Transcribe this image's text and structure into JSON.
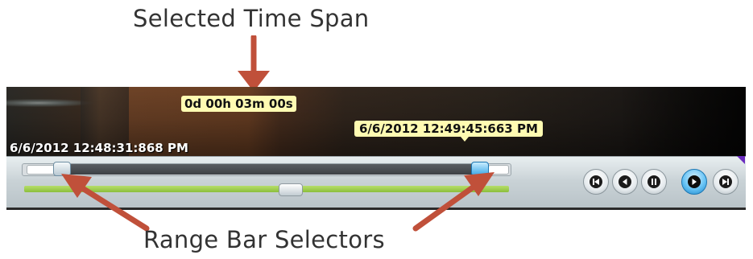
{
  "annotations": {
    "top": "Selected Time Span",
    "bottom": "Range Bar Selectors"
  },
  "timeline": {
    "selected_span": "0d 00h 03m 00s",
    "start_time": "6/6/2012 12:48:31:868 PM",
    "end_time": "6/6/2012 12:49:45:663 PM",
    "range_start_fraction": 0.08,
    "range_end_fraction": 0.92,
    "playback_position_fraction": 0.53
  },
  "controls": [
    {
      "name": "skip-to-start",
      "icon": "skip-start-icon"
    },
    {
      "name": "step-back",
      "icon": "step-back-icon"
    },
    {
      "name": "pause",
      "icon": "pause-icon"
    },
    {
      "name": "play",
      "icon": "play-icon"
    },
    {
      "name": "skip-to-end",
      "icon": "skip-end-icon"
    }
  ],
  "colors": {
    "label_bg": "#fffbb2",
    "arrow": "#c0503a",
    "progress": "#8cbe3c",
    "active_selector": "#39a7e6",
    "accent_corner": "#6a2bbf"
  }
}
